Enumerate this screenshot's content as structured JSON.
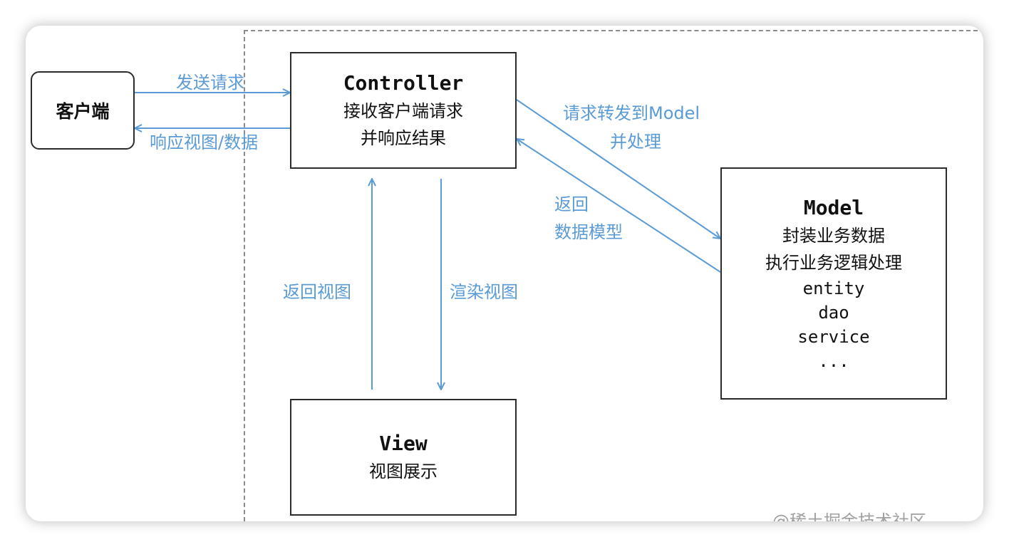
{
  "nodes": {
    "client": {
      "label": "客户端"
    },
    "controller": {
      "title": "Controller",
      "lines": [
        "接收客户端请求",
        "并响应结果"
      ]
    },
    "model": {
      "title": "Model",
      "lines": [
        "封装业务数据",
        "执行业务逻辑处理"
      ],
      "items": [
        "entity",
        "dao",
        "service",
        "..."
      ]
    },
    "view": {
      "title": "View",
      "lines": [
        "视图展示"
      ]
    }
  },
  "edges": {
    "send_request": "发送请求",
    "respond": "响应视图/数据",
    "forward_to_model": [
      "请求转发到Model",
      "并处理"
    ],
    "return_model": [
      "返回",
      "数据模型"
    ],
    "return_view": "返回视图",
    "render_view": "渲染视图"
  },
  "watermark": "@稀土掘金技术社区",
  "colors": {
    "arrow": "#5b9bd5",
    "box_border": "#2b2b2b",
    "dashed": "#8c8c8c"
  }
}
